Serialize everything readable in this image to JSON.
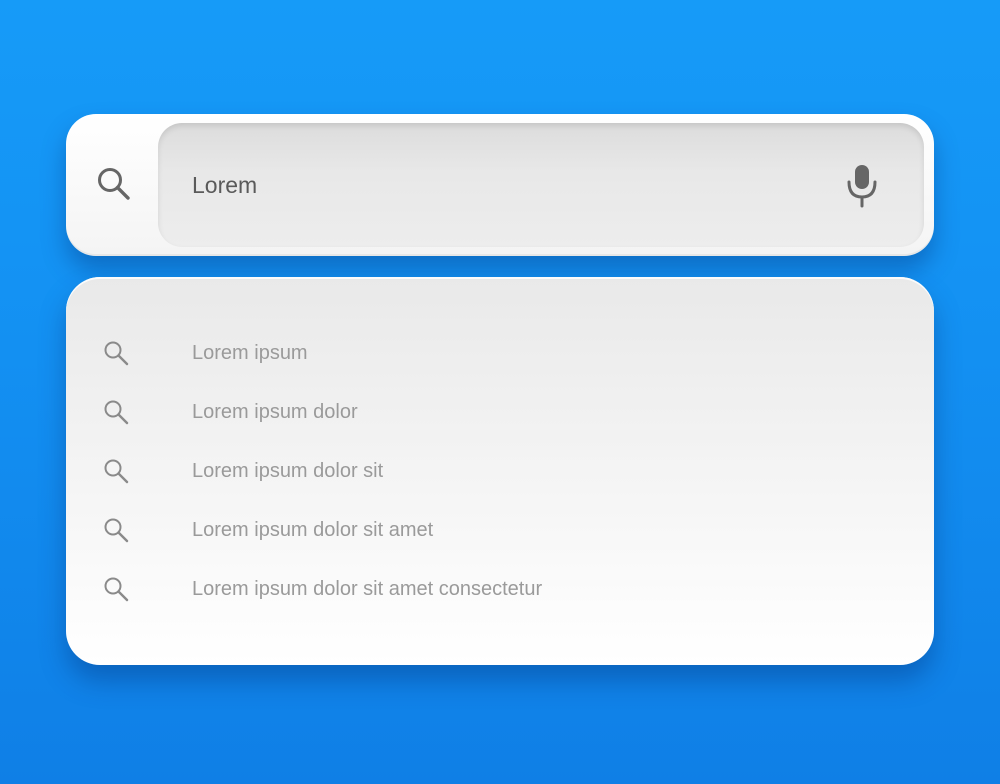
{
  "search": {
    "query": "Lorem",
    "search_icon": "search-icon",
    "mic_icon": "microphone-icon"
  },
  "suggestions": {
    "icon": "search-icon",
    "items": [
      {
        "label": "Lorem ipsum"
      },
      {
        "label": "Lorem ipsum dolor"
      },
      {
        "label": "Lorem ipsum dolor sit"
      },
      {
        "label": "Lorem ipsum dolor sit amet"
      },
      {
        "label": "Lorem ipsum dolor sit amet consectetur"
      }
    ]
  },
  "colors": {
    "background": "#1390f2",
    "surface": "#ffffff",
    "field": "#e6e6e6",
    "query_text": "#5a5a5a",
    "suggestion_text": "#9a9a9a",
    "icon": "#666666"
  }
}
